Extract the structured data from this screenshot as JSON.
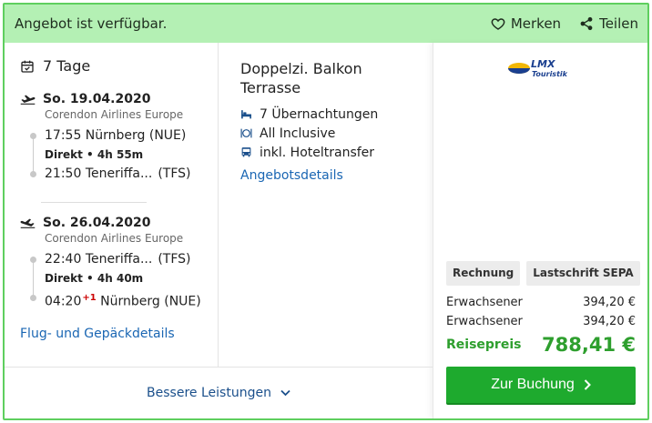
{
  "banner": {
    "title": "Angebot ist verfügbar.",
    "merken_label": "Merken",
    "teilen_label": "Teilen"
  },
  "trip": {
    "duration": "7 Tage"
  },
  "outbound": {
    "date": "So. 19.04.2020",
    "airline": "Corendon Airlines Europe",
    "departure": "17:55 Nürnberg (NUE)",
    "stops": "Direkt",
    "duration": "4h 55m",
    "arrival_time": "21:50",
    "arrival_city": "Teneriffa...",
    "arrival_code": "(TFS)"
  },
  "return": {
    "date": "So. 26.04.2020",
    "airline": "Corendon Airlines Europe",
    "departure_time": "22:40",
    "departure_city": "Teneriffa...",
    "departure_code": "(TFS)",
    "stops": "Direkt",
    "duration": "4h 40m",
    "arrival_time": "04:20",
    "arrival_day_offset": "+1",
    "arrival_city": "Nürnberg (NUE)"
  },
  "flight_details_link": "Flug- und Gepäckdetails",
  "room": {
    "title_line1": "Doppelzi. Balkon",
    "title_line2": "Terrasse",
    "features": [
      "7 Übernachtungen",
      "All Inclusive",
      "inkl. Hoteltransfer"
    ],
    "details_link": "Angebotsdetails"
  },
  "operator": {
    "logo_text_top": "LMX",
    "logo_text_bottom": "Touristik"
  },
  "payment_methods": [
    "Rechnung",
    "Lastschrift SEPA"
  ],
  "prices": [
    {
      "label": "Erwachsener",
      "value": "394,20 €"
    },
    {
      "label": "Erwachsener",
      "value": "394,20 €"
    }
  ],
  "total": {
    "label": "Reisepreis",
    "value": "788,41 €"
  },
  "book_button": "Zur Buchung",
  "more_services": "Bessere Leistungen",
  "colors": {
    "banner_bg": "#b4f0b4",
    "border": "#5fcf5f",
    "accent_green": "#1eaa2e",
    "price_green": "#2e9f2e",
    "link_blue": "#1a66b3"
  }
}
